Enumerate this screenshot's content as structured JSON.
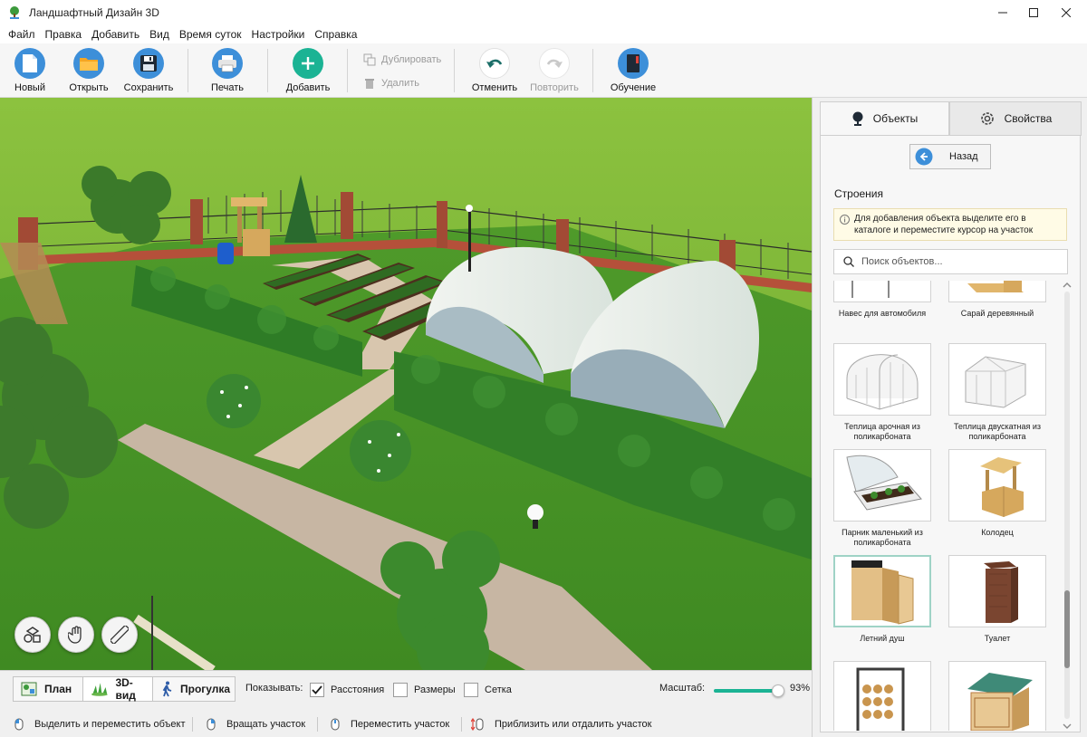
{
  "window": {
    "title": "Ландшафтный Дизайн 3D"
  },
  "menu": [
    "Файл",
    "Правка",
    "Добавить",
    "Вид",
    "Время суток",
    "Настройки",
    "Справка"
  ],
  "toolbar": {
    "new": "Новый",
    "open": "Открыть",
    "save": "Сохранить",
    "print": "Печать",
    "add": "Добавить",
    "duplicate": "Дублировать",
    "delete": "Удалить",
    "undo": "Отменить",
    "redo": "Повторить",
    "tutorial": "Обучение"
  },
  "colors": {
    "accent": "#1bb394",
    "blue": "#3d8fd9",
    "orange": "#f5a623",
    "grass": "#7cb33a"
  },
  "viewbar": {
    "plan": "План",
    "view3d": "3D-вид",
    "walk": "Прогулка",
    "show_label": "Показывать:",
    "distances": {
      "label": "Расстояния",
      "checked": true
    },
    "sizes": {
      "label": "Размеры",
      "checked": false
    },
    "grid": {
      "label": "Сетка",
      "checked": false
    },
    "scale_label": "Масштаб:",
    "scale_value": "93%",
    "scale_fraction": 0.93
  },
  "statusbar": [
    "Выделить и переместить объект",
    "Вращать участок",
    "Переместить участок",
    "Приблизить или отдалить участок"
  ],
  "panel": {
    "tab_objects": "Объекты",
    "tab_properties": "Свойства",
    "back": "Назад",
    "section": "Строения",
    "hint": "Для добавления объекта выделите его в каталоге и переместите курсор на участок",
    "search_placeholder": "Поиск объектов...",
    "items": [
      {
        "label": "Навес для автомобиля"
      },
      {
        "label": "Сарай деревянный"
      },
      {
        "label": "Теплица арочная из поликарбоната"
      },
      {
        "label": "Теплица двускатная из поликарбоната"
      },
      {
        "label": "Парник маленький из поликарбоната"
      },
      {
        "label": "Колодец"
      },
      {
        "label": "Летний душ",
        "selected": true
      },
      {
        "label": "Туалет"
      }
    ]
  }
}
